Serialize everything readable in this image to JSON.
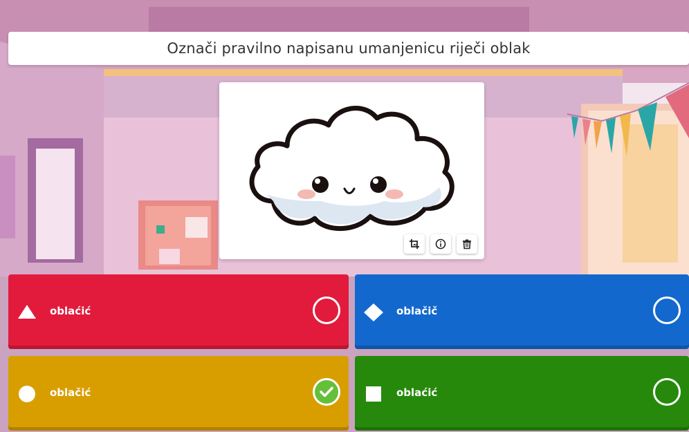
{
  "question": {
    "text": "Označi pravilno napisanu umanjenicu riječi oblak"
  },
  "image": {
    "icon": "smiling-cloud",
    "tools": [
      {
        "id": "crop",
        "icon": "crop-icon"
      },
      {
        "id": "info",
        "icon": "info-icon"
      },
      {
        "id": "delete",
        "icon": "trash-icon"
      }
    ]
  },
  "answers": [
    {
      "label": "oblaćić",
      "shape": "triangle",
      "color": "#e21b3c",
      "correct": false
    },
    {
      "label": "oblačič",
      "shape": "diamond",
      "color": "#1368ce",
      "correct": false
    },
    {
      "label": "oblačić",
      "shape": "circle",
      "color": "#d89e00",
      "correct": true
    },
    {
      "label": "oblaćić",
      "shape": "square",
      "color": "#26890c",
      "correct": false
    }
  ],
  "colors": {
    "correct_check": "#66bf39"
  }
}
